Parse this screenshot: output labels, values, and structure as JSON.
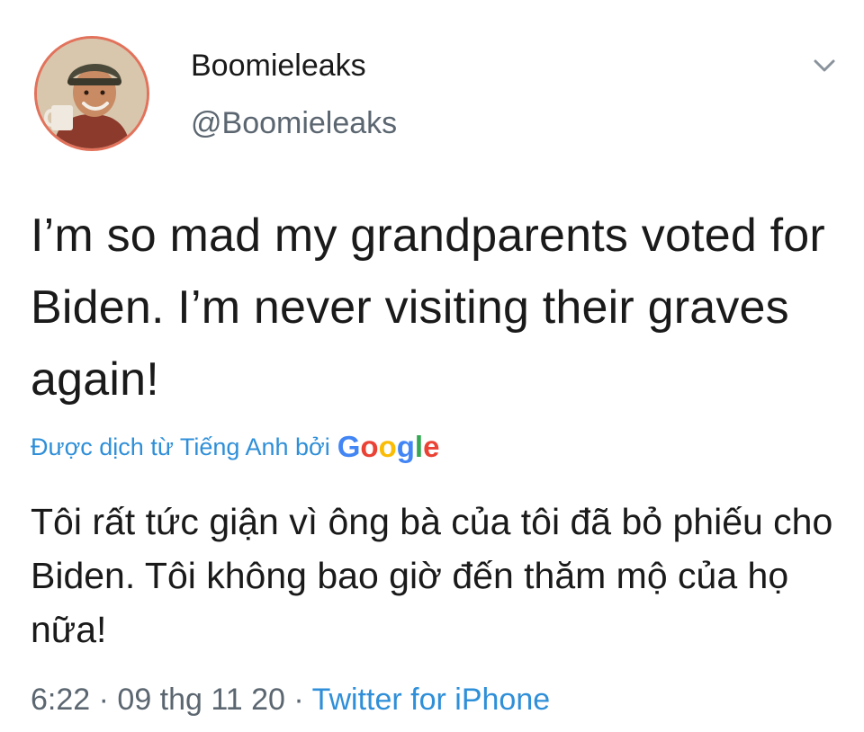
{
  "user": {
    "display_name": "Boomieleaks",
    "handle": "@Boomieleaks",
    "avatar_icon": "profile-avatar"
  },
  "tweet": {
    "text": "I’m so mad my grandparents voted for Biden. I’m never visiting their graves again!",
    "translation_label": "Được dịch từ Tiếng Anh bởi",
    "translation_provider": "Google",
    "translated_text": "Tôi rất tức giận vì ông bà của tôi đã bỏ phiếu cho Biden. Tôi không bao giờ đến thăm mộ của họ nữa!"
  },
  "meta": {
    "time": "6:22",
    "separator": "·",
    "date": "09 thg 11 20",
    "source": "Twitter for iPhone"
  },
  "colors": {
    "link": "#2f8fd8",
    "secondary_text": "#5b6670",
    "avatar_ring": "#e2725b"
  },
  "icons": {
    "menu": "chevron-down-icon"
  }
}
